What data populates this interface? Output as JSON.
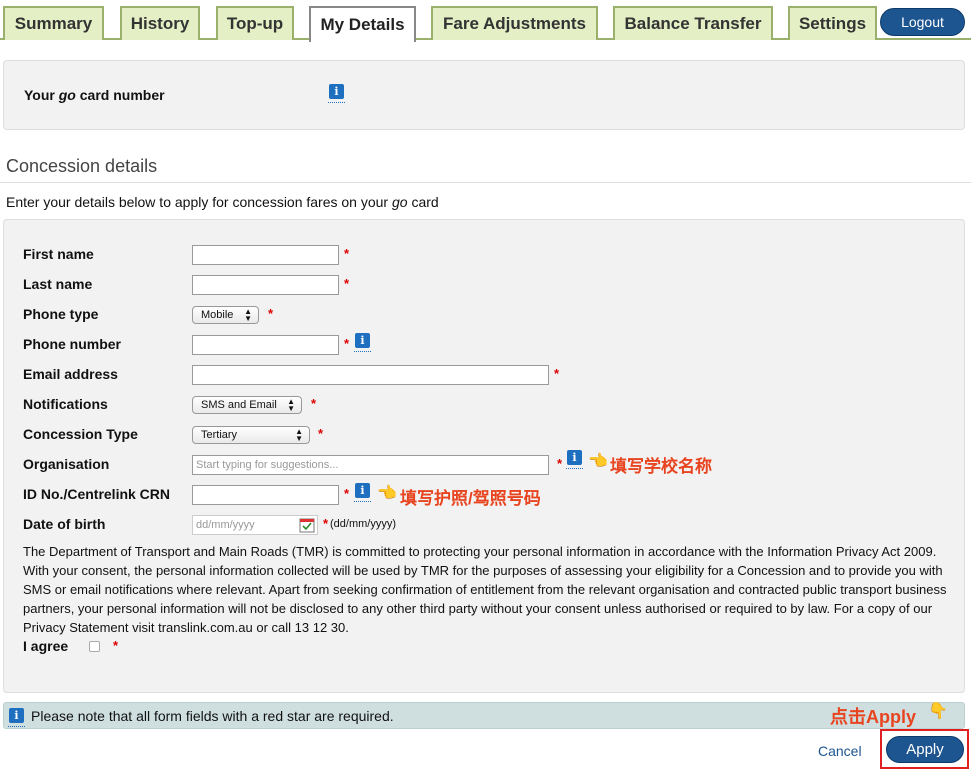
{
  "tabs": [
    {
      "label": "Summary"
    },
    {
      "label": "History"
    },
    {
      "label": "Top-up"
    },
    {
      "label": "My Details"
    },
    {
      "label": "Fare Adjustments"
    },
    {
      "label": "Balance Transfer"
    },
    {
      "label": "Settings"
    }
  ],
  "logout_label": "Logout",
  "card": {
    "label_pre": "Your ",
    "label_em": "go",
    "label_post": " card number"
  },
  "concession": {
    "title": "Concession details",
    "intro_pre": "Enter your details below to apply for concession fares on your ",
    "intro_em": "go",
    "intro_post": " card"
  },
  "form": {
    "first_name": {
      "label": "First name",
      "value": ""
    },
    "last_name": {
      "label": "Last name",
      "value": ""
    },
    "phone_type": {
      "label": "Phone type",
      "value": "Mobile"
    },
    "phone_number": {
      "label": "Phone number",
      "value": ""
    },
    "email": {
      "label": "Email address",
      "value": ""
    },
    "notifications": {
      "label": "Notifications",
      "value": "SMS and Email"
    },
    "concession_type": {
      "label": "Concession Type",
      "value": "Tertiary"
    },
    "organisation": {
      "label": "Organisation",
      "value": "",
      "placeholder": "Start typing for suggestions..."
    },
    "id_no": {
      "label": "ID No./Centrelink CRN",
      "value": ""
    },
    "dob": {
      "label": "Date of birth",
      "placeholder": "dd/mm/yyyy",
      "hint": "(dd/mm/yyyy)"
    },
    "agree_label": "I agree",
    "required_mark": "*"
  },
  "annotations": {
    "organisation_note": "填写学校名称",
    "id_note": "填写护照/驾照号码",
    "apply_note": "点击Apply"
  },
  "privacy_text": "The Department of Transport and Main Roads (TMR) is committed to protecting your personal information in accordance with the Information Privacy Act 2009. With your consent, the personal information collected will be used by TMR for the purposes of assessing your eligibility for a Concession and to provide you with SMS or email notifications where relevant. Apart from seeking confirmation of entitlement from the relevant organisation and contracted public transport business partners, your personal information will not be disclosed to any other third party without your consent unless authorised or required to by law. For a copy of our Privacy Statement visit translink.com.au or call 13 12 30.",
  "required_note": "Please note that all form fields with a red star are required.",
  "buttons": {
    "cancel": "Cancel",
    "apply": "Apply"
  },
  "colors": {
    "tab_bg": "#e4efc5",
    "tab_border": "#9bb06b",
    "primary_button": "#1c5590",
    "required": "#dd0000",
    "annotation": "#e8441f"
  }
}
